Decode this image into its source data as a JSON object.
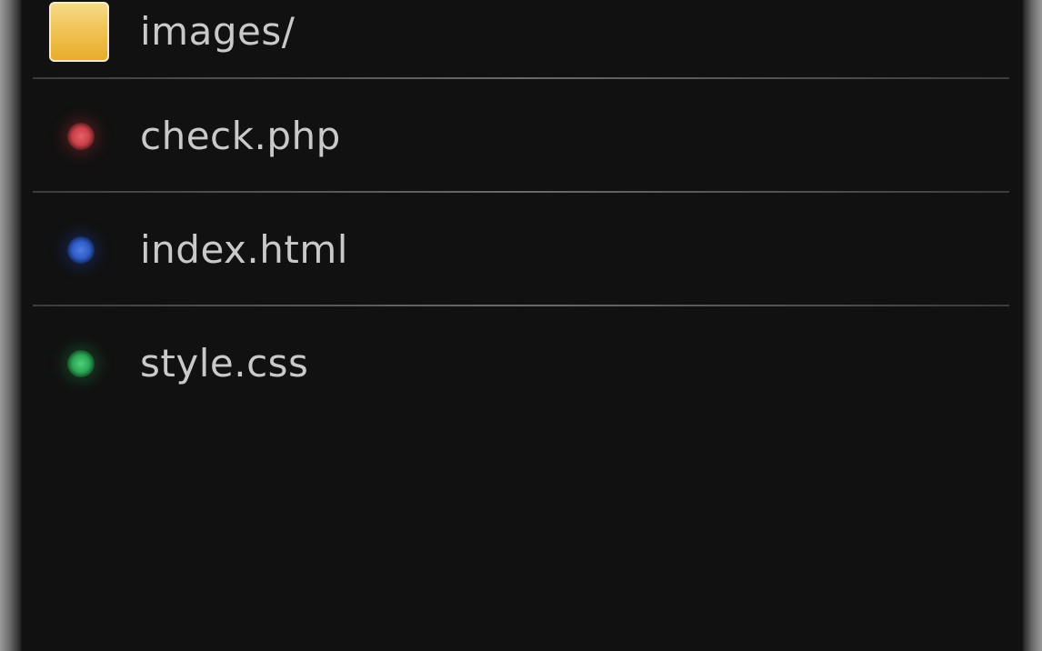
{
  "file_list": {
    "items": [
      {
        "name": "images/",
        "type": "folder",
        "icon": "folder-icon",
        "icon_color": "#F1C457"
      },
      {
        "name": "check.php",
        "type": "file",
        "icon": "red-dot-icon",
        "icon_color": "#D94B53"
      },
      {
        "name": "index.html",
        "type": "file",
        "icon": "blue-dot-icon",
        "icon_color": "#3567D6"
      },
      {
        "name": "style.css",
        "type": "file",
        "icon": "green-dot-icon",
        "icon_color": "#33B860"
      }
    ]
  }
}
